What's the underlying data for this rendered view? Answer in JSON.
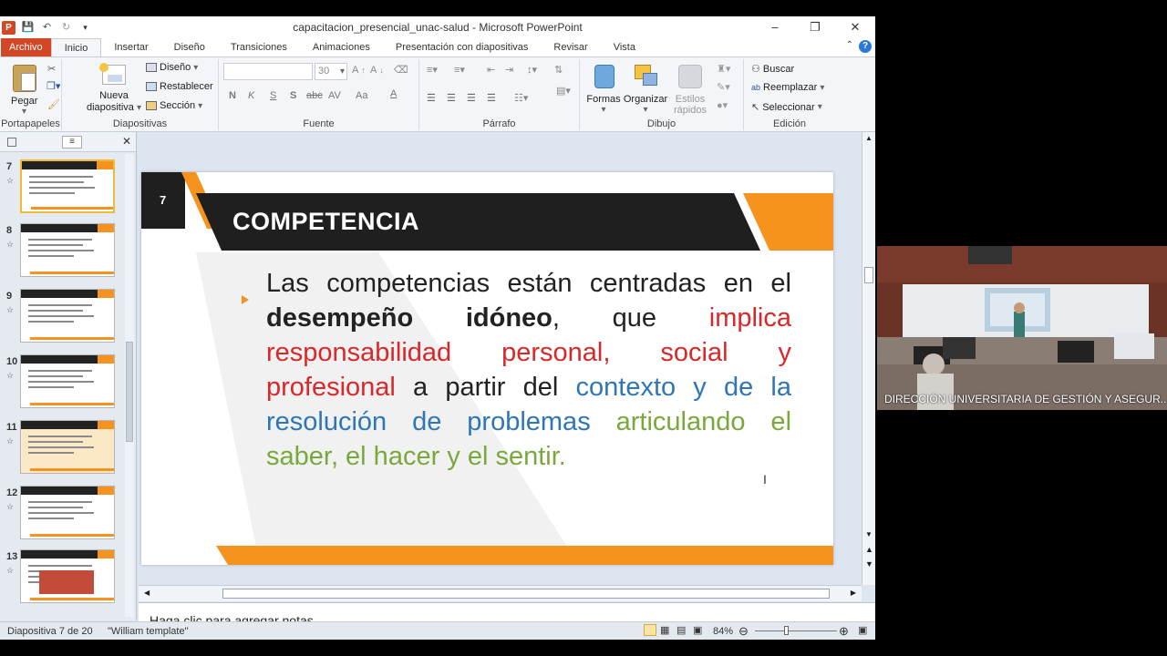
{
  "window": {
    "title": "capacitacion_presencial_unac-salud  -  Microsoft PowerPoint"
  },
  "tabs": [
    {
      "label": "Archivo"
    },
    {
      "label": "Inicio"
    },
    {
      "label": "Insertar"
    },
    {
      "label": "Diseño"
    },
    {
      "label": "Transiciones"
    },
    {
      "label": "Animaciones"
    },
    {
      "label": "Presentación con diapositivas"
    },
    {
      "label": "Revisar"
    },
    {
      "label": "Vista"
    }
  ],
  "ribbon": {
    "portapapeles": {
      "pegar": "Pegar",
      "label": "Portapapeles"
    },
    "diapositivas": {
      "nueva": "Nueva",
      "diapositiva": "diapositiva",
      "diseno": "Diseño",
      "restablecer": "Restablecer",
      "seccion": "Sección",
      "label": "Diapositivas"
    },
    "fuente": {
      "size": "30",
      "label": "Fuente",
      "bold": "N",
      "italic": "K",
      "underline": "S",
      "shadow": "S",
      "strike": "abc",
      "spacing": "AV",
      "case": "Aa"
    },
    "parrafo": {
      "label": "Párrafo"
    },
    "dibujo": {
      "formas": "Formas",
      "organizar": "Organizar",
      "estilos": "Estilos",
      "rapidos": "rápidos",
      "label": "Dibujo"
    },
    "edicion": {
      "buscar": "Buscar",
      "reemplazar": "Reemplazar",
      "seleccionar": "Seleccionar",
      "label": "Edición"
    }
  },
  "thumbnails": [
    {
      "num": "7"
    },
    {
      "num": "8"
    },
    {
      "num": "9"
    },
    {
      "num": "10"
    },
    {
      "num": "11"
    },
    {
      "num": "12"
    },
    {
      "num": "13"
    }
  ],
  "slide": {
    "number": "7",
    "title": "COMPETENCIA",
    "parts": [
      {
        "text": "Las competencias están centradas en el "
      },
      {
        "text": "desempeño idóneo",
        "bold": true
      },
      {
        "text": ", que "
      },
      {
        "text": "implica responsabilidad personal, social y profesional",
        "color": "#d8282a"
      },
      {
        "text": " a partir del "
      },
      {
        "text": "contexto y de la resolución de problemas",
        "color": "#2e76b6"
      },
      {
        "text": " "
      },
      {
        "text": "articulando el saber, el hacer y el sentir.",
        "color": "#7aa83c"
      }
    ]
  },
  "notes": {
    "placeholder": "Haga clic para agregar notas"
  },
  "status": {
    "slide": "Diapositiva 7 de 20",
    "template": "\"William template\"",
    "zoom": "84%"
  },
  "video": {
    "label": "DIRECCIÓN UNIVERSITARIA DE GESTIÓN Y ASEGUR..."
  },
  "colors": {
    "accent": "#f5931e",
    "title_band": "#1f1f1f",
    "file_tab": "#d24726",
    "red": "#d8282a",
    "blue": "#2e76b6",
    "green": "#7aa83c"
  }
}
